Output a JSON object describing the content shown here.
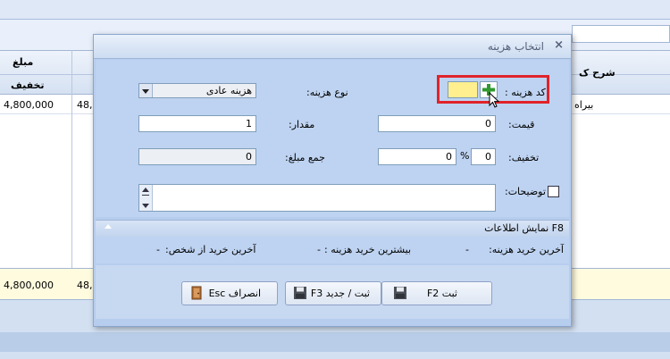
{
  "background": {
    "grid_headers": {
      "amount": "مبلغ",
      "discount": "تخفیف",
      "description": "شرح ک"
    },
    "row": {
      "discount": "4,800,000",
      "amount_partial": "48,",
      "desc_partial": "بیراه"
    },
    "total": {
      "discount": "4,800,000",
      "amount_partial": "48,"
    }
  },
  "dialog": {
    "title": "انتخاب هزینه",
    "close_symbol": "×",
    "fields": {
      "cost_code_label": "کد هزینه :",
      "cost_code_value": "",
      "cost_type_label": "نوع هزینه:",
      "cost_type_value": "هزینه عادی",
      "price_label": "قیمت:",
      "price_value": "0",
      "quantity_label": "مقدار:",
      "quantity_value": "1",
      "discount_label": "تخفیف:",
      "discount_value": "0",
      "percent_symbol": "%",
      "discount_percent_value": "0",
      "total_label": "جمع مبلغ:",
      "total_value": "0",
      "notes_label": "توضیحات:"
    },
    "info_section": {
      "header": "F8 نمایش اطلاعات",
      "last_purchase_cost": "آخرین خرید هزینه:",
      "last_purchase_cost_value": "-",
      "most_purchase_cost": "بیشترین خرید هزینه :",
      "most_purchase_cost_value": "-",
      "last_purchase_person": "آخرین خرید از شخص:",
      "last_purchase_person_value": "-"
    },
    "buttons": {
      "save": "ثبت F2",
      "save_new": "ثبت / جدید F3",
      "cancel": "انصراف Esc"
    }
  },
  "colors": {
    "dialog_bg": "#b7cdee",
    "highlight_border": "#e0232a",
    "code_input_bg": "#ffef8f",
    "add_icon": "#2f9a2f"
  }
}
